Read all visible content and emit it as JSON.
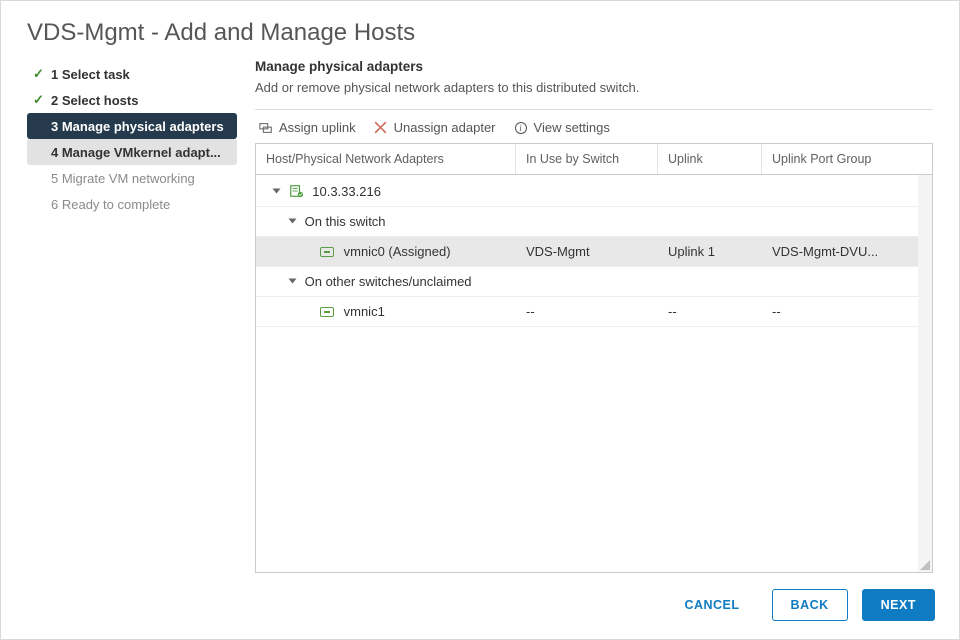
{
  "dialog": {
    "title": "VDS-Mgmt - Add and Manage Hosts"
  },
  "wizard": {
    "steps": [
      {
        "label": "1 Select task"
      },
      {
        "label": "2 Select hosts"
      },
      {
        "label": "3 Manage physical adapters"
      },
      {
        "label": "4 Manage VMkernel adapt..."
      },
      {
        "label": "5 Migrate VM networking"
      },
      {
        "label": "6 Ready to complete"
      }
    ]
  },
  "panel": {
    "title": "Manage physical adapters",
    "subtitle": "Add or remove physical network adapters to this distributed switch."
  },
  "toolbar": {
    "assign": "Assign uplink",
    "unassign": "Unassign adapter",
    "view": "View settings"
  },
  "grid": {
    "headers": {
      "adapter": "Host/Physical Network Adapters",
      "switch": "In Use by Switch",
      "uplink": "Uplink",
      "portgroup": "Uplink Port Group"
    },
    "host": "10.3.33.216",
    "group_on_switch": "On this switch",
    "group_other": "On other switches/unclaimed",
    "vmnic0": {
      "name": "vmnic0 (Assigned)",
      "switch": "VDS-Mgmt",
      "uplink": "Uplink 1",
      "portgroup": "VDS-Mgmt-DVU..."
    },
    "vmnic1": {
      "name": "vmnic1",
      "switch": "--",
      "uplink": "--",
      "portgroup": "--"
    }
  },
  "footer": {
    "cancel": "CANCEL",
    "back": "BACK",
    "next": "NEXT"
  }
}
